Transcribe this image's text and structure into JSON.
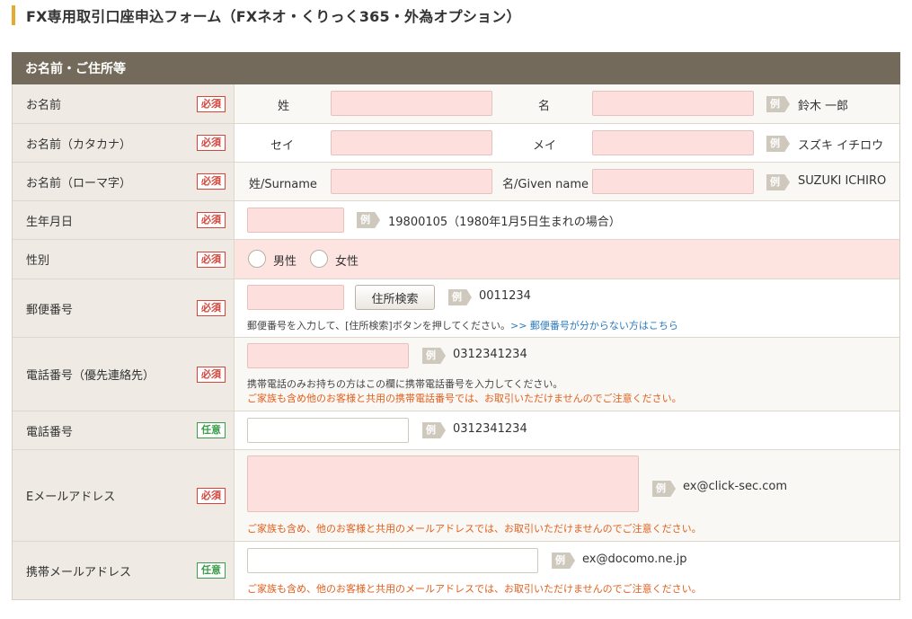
{
  "page_title": "FX専用取引口座申込フォーム（FXネオ・くりっく365・外為オプション）",
  "section": {
    "title": "お名前・ご住所等"
  },
  "badges": {
    "required": "必須",
    "optional": "任意"
  },
  "example_tag": "例",
  "rows": {
    "name": {
      "label": "お名前",
      "last_label": "姓",
      "first_label": "名",
      "example": "鈴木 一郎"
    },
    "kana": {
      "label": "お名前（カタカナ）",
      "last_label": "セイ",
      "first_label": "メイ",
      "example": "スズキ イチロウ"
    },
    "roman": {
      "label": "お名前（ローマ字）",
      "last_label": "姓/Surname",
      "first_label": "名/Given name",
      "example": "SUZUKI ICHIRO"
    },
    "birth": {
      "label": "生年月日",
      "example": "19800105（1980年1月5日生まれの場合）"
    },
    "gender": {
      "label": "性別",
      "options": [
        "男性",
        "女性"
      ]
    },
    "postal": {
      "label": "郵便番号",
      "button": "住所検索",
      "example": "0011234",
      "note": "郵便番号を入力して、[住所検索]ボタンを押してください。",
      "link": ">> 郵便番号が分からない方はこちら"
    },
    "phone_main": {
      "label": "電話番号（優先連絡先）",
      "example": "0312341234",
      "note": "携帯電話のみお持ちの方はこの欄に携帯電話番号を入力してください。",
      "warning": "ご家族も含め他のお客様と共用の携帯電話番号では、お取引いただけませんのでご注意ください。"
    },
    "phone": {
      "label": "電話番号",
      "example": "0312341234"
    },
    "email": {
      "label": "Eメールアドレス",
      "example": "ex@click-sec.com",
      "warning": "ご家族も含め、他のお客様と共用のメールアドレスでは、お取引いただけませんのでご注意ください。"
    },
    "mobile_email": {
      "label": "携帯メールアドレス",
      "example": "ex@docomo.ne.jp",
      "warning": "ご家族も含め、他のお客様と共用のメールアドレスでは、お取引いただけませんのでご注意ください。"
    }
  },
  "colors": {
    "accent_bar": "#e8a931",
    "header_bg": "#746a5c",
    "required": "#d2463c",
    "optional": "#3a9d4a",
    "warning": "#e0601f",
    "link": "#2a7ac0",
    "field_pink": "#fde0de"
  }
}
